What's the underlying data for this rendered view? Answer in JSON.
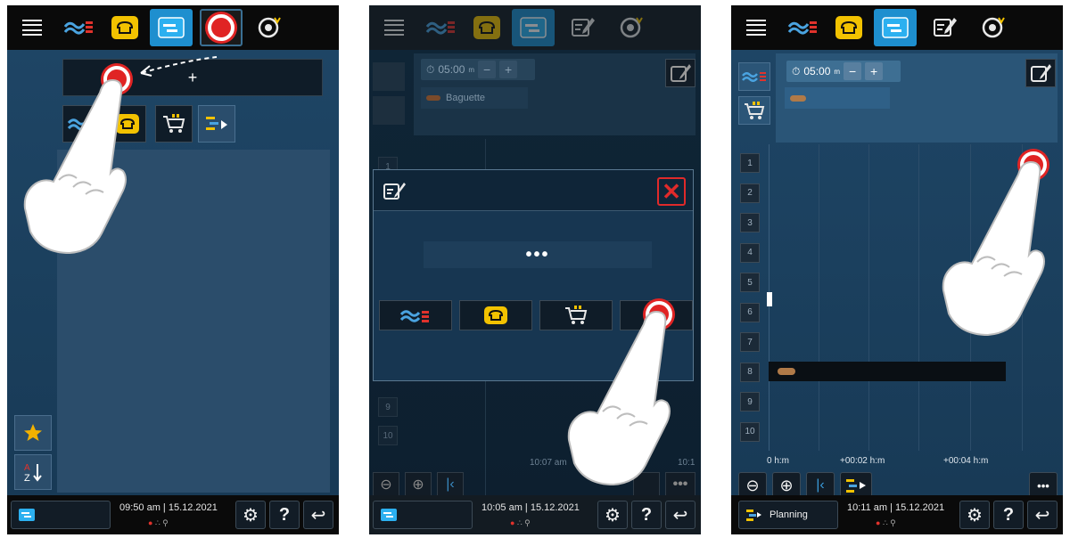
{
  "panel1": {
    "new_label": "+",
    "time": "09:50 am | 15.12.2021"
  },
  "panel2": {
    "timer": "05:00",
    "timer_unit": "m",
    "program_name": "Baguette",
    "dialog_text": "•••",
    "rack_left": [
      "1",
      "9",
      "10"
    ],
    "time_ticks": [
      "10:07 am",
      "am",
      "10:1"
    ],
    "time": "10:05 am | 15.12.2021"
  },
  "panel3": {
    "timer": "05:00",
    "timer_unit": "m",
    "racks": [
      "1",
      "2",
      "3",
      "4",
      "5",
      "6",
      "7",
      "8",
      "9",
      "10"
    ],
    "ticks": [
      "0 h:m",
      "+00:02 h:m",
      "+00:04 h:m"
    ],
    "bottom_mode": "Planning",
    "time": "10:11 am | 15.12.2021",
    "more_label": "•••"
  },
  "colors": {
    "accent_blue": "#1e8fcf",
    "touch_red": "#e02424",
    "bread_yellow": "#f2c200"
  }
}
